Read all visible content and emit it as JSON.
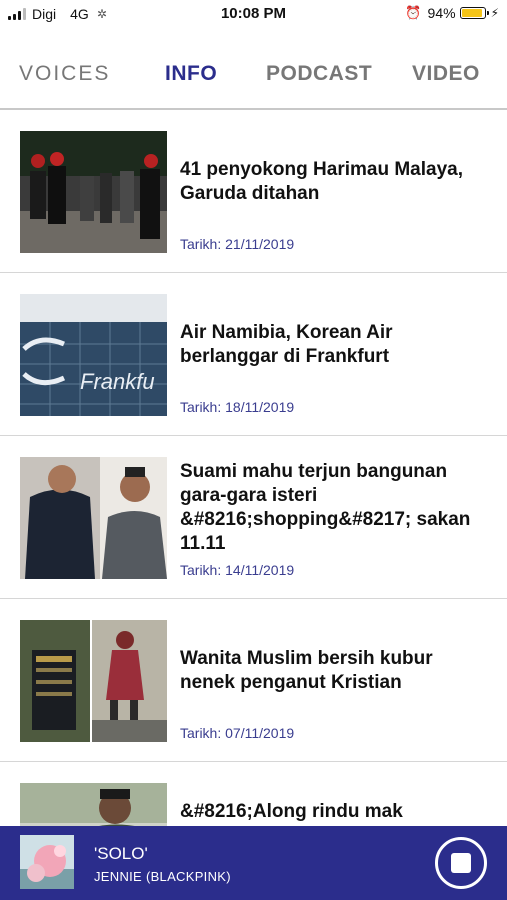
{
  "status_bar": {
    "carrier": "Digi",
    "network": "4G",
    "time": "10:08 PM",
    "battery": "94%",
    "battery_level": 0.94
  },
  "nav": {
    "logo": "VOICES",
    "tabs": [
      {
        "label": "INFO",
        "active": true
      },
      {
        "label": "PODCAST",
        "active": false
      },
      {
        "label": "VIDEO",
        "active": false
      }
    ],
    "active_color": "#2b2d8c"
  },
  "articles": [
    {
      "title": "41 penyokong Harimau Malaya, Garuda ditahan",
      "date": "Tarikh: 21/11/2019"
    },
    {
      "title": "Air Namibia, Korean Air berlanggar di Frankfurt",
      "date": "Tarikh: 18/11/2019",
      "image_text": "Frankfu"
    },
    {
      "title": "Suami mahu terjun bangunan gara-gara isteri &#8216;shopping&#8217; sakan 11.11",
      "date": "Tarikh: 14/11/2019"
    },
    {
      "title": "Wanita Muslim bersih kubur nenek penganut Kristian",
      "date": "Tarikh: 07/11/2019"
    },
    {
      "title": "&#8216;Along rindu mak",
      "date": ""
    }
  ],
  "player": {
    "title": "'SOLO'",
    "artist": "JENNIE (BLACKPINK)",
    "background": "#2b2d8c"
  }
}
